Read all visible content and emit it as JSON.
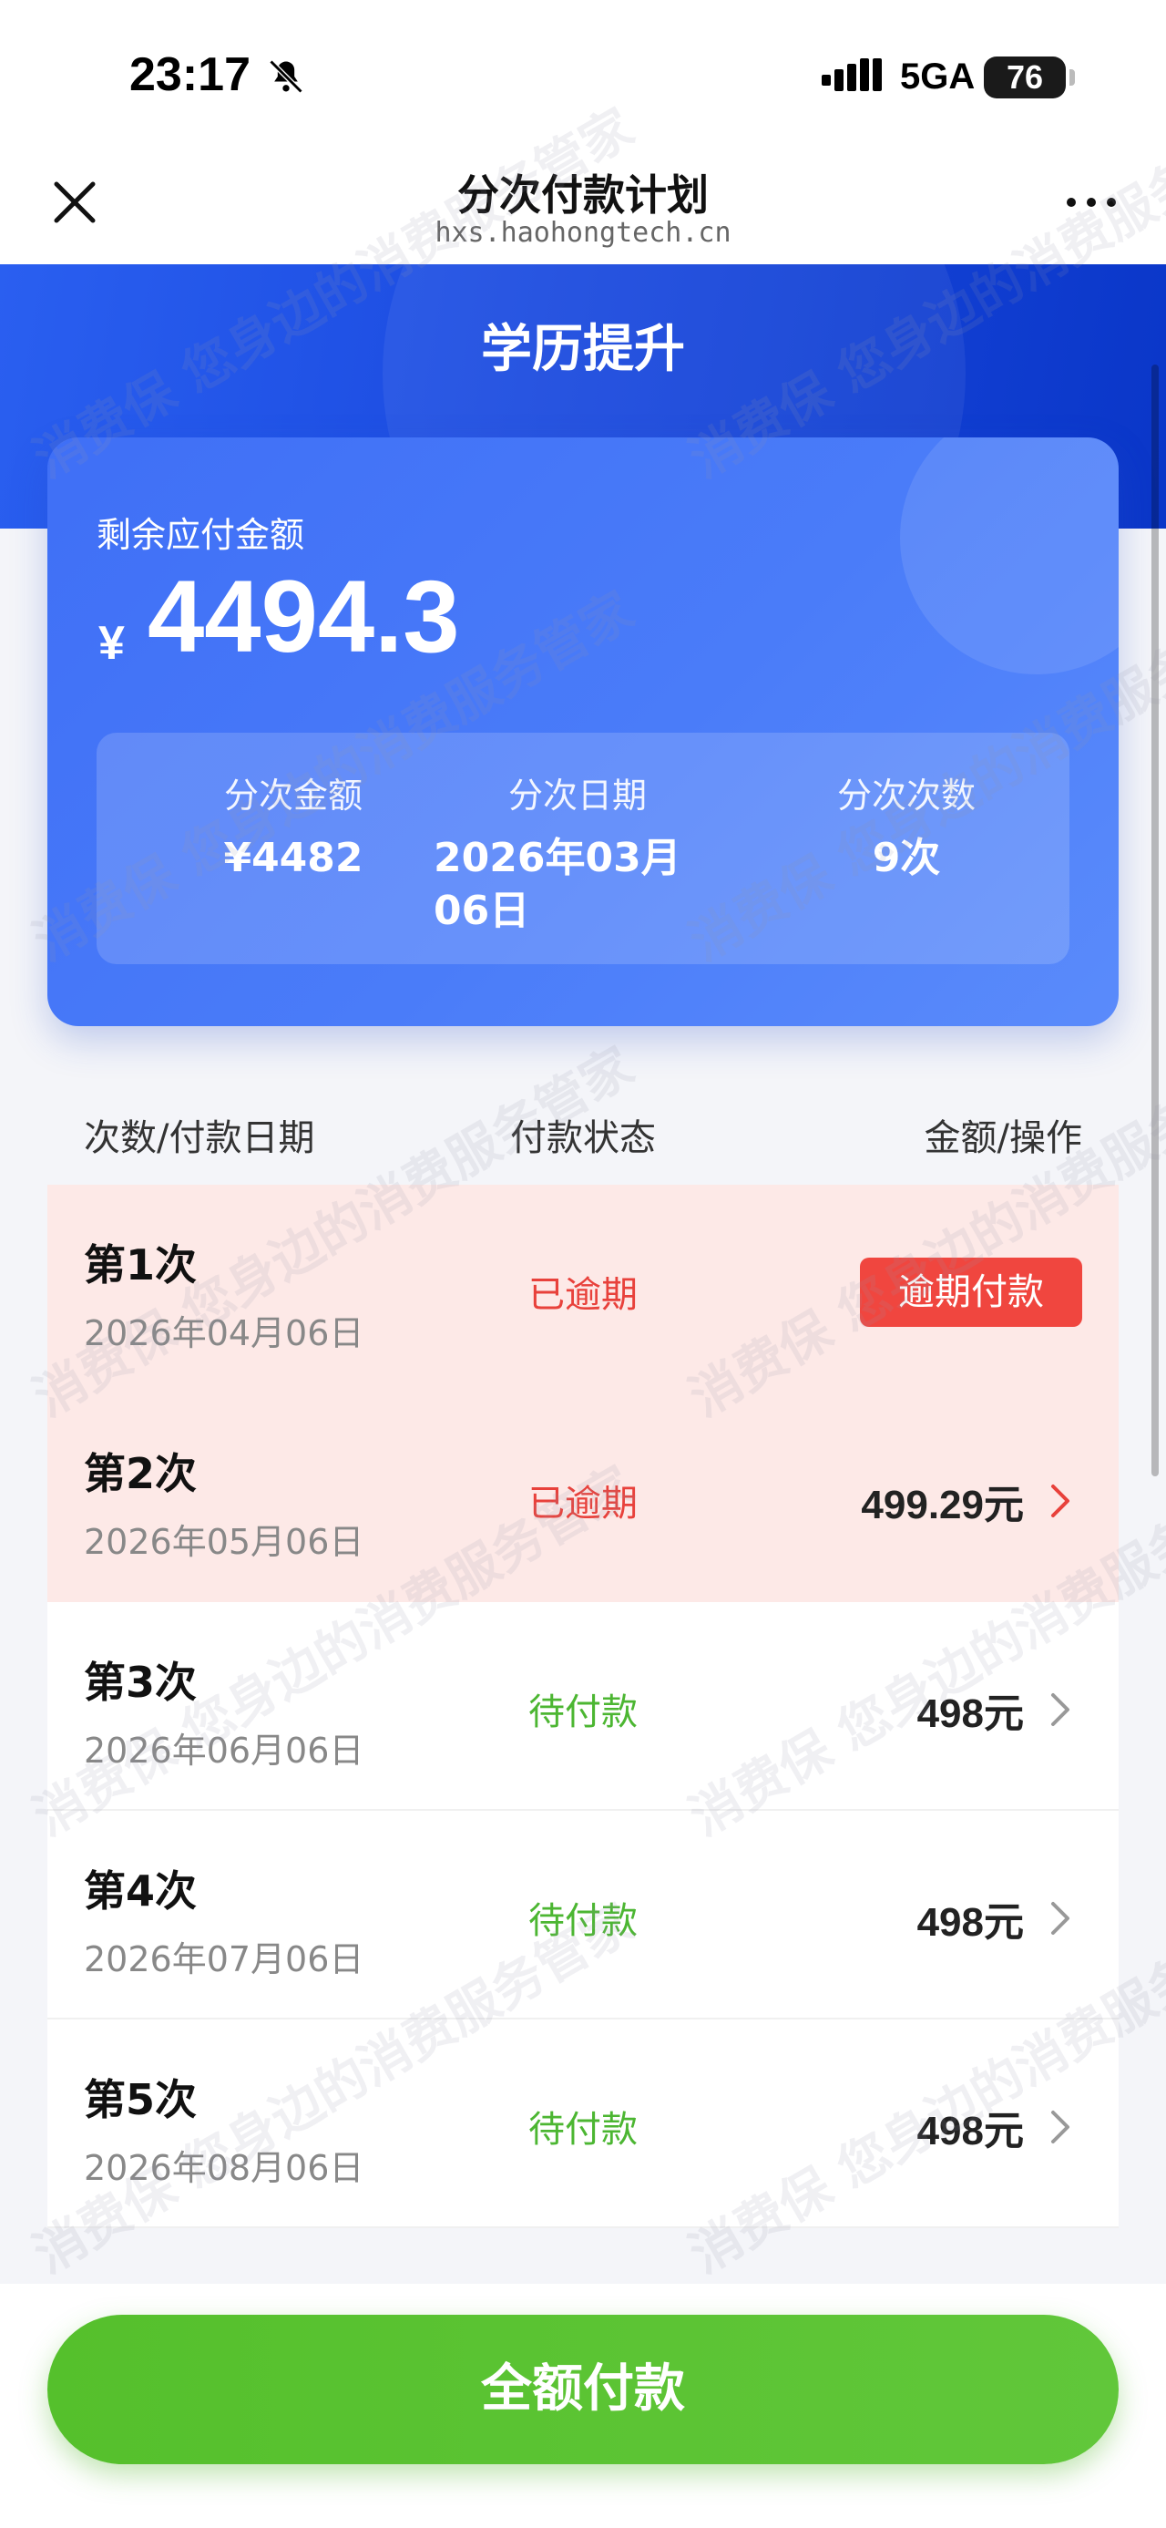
{
  "status_bar": {
    "time": "23:17",
    "network": "5GA",
    "battery": "76"
  },
  "nav": {
    "title": "分次付款计划",
    "url": "hxs.haohongtech.cn"
  },
  "hero": {
    "title": "学历提升"
  },
  "summary": {
    "label": "剩余应付金额",
    "currency": "¥",
    "amount": "4494.3",
    "installment_amount_label": "分次金额",
    "installment_amount": "¥4482",
    "installment_date_label": "分次日期",
    "installment_date": "2026年03月06日",
    "installment_count_label": "分次次数",
    "installment_count": "9次"
  },
  "table": {
    "headers": [
      "次数/付款日期",
      "付款状态",
      "金额/操作"
    ],
    "rows": [
      {
        "num": "第1次",
        "date": "2026年04月06日",
        "status": "已逾期",
        "status_type": "overdue",
        "action": "逾期付款"
      },
      {
        "num": "第2次",
        "date": "2026年05月06日",
        "status": "已逾期",
        "status_type": "overdue",
        "amount": "499.29元"
      },
      {
        "num": "第3次",
        "date": "2026年06月06日",
        "status": "待付款",
        "status_type": "pending",
        "amount": "498元"
      },
      {
        "num": "第4次",
        "date": "2026年07月06日",
        "status": "待付款",
        "status_type": "pending",
        "amount": "498元"
      },
      {
        "num": "第5次",
        "date": "2026年08月06日",
        "status": "待付款",
        "status_type": "pending",
        "amount": "498元"
      }
    ]
  },
  "bottom": {
    "pay_full_label": "全额付款"
  },
  "watermark": {
    "text": "消费保 您身边的消费服务管家"
  },
  "colors": {
    "primary_blue": "#1b4be0",
    "card_blue": "#4a7cf9",
    "overdue_red": "#e8413b",
    "pending_green": "#4cb632",
    "button_green": "#55c02c"
  }
}
